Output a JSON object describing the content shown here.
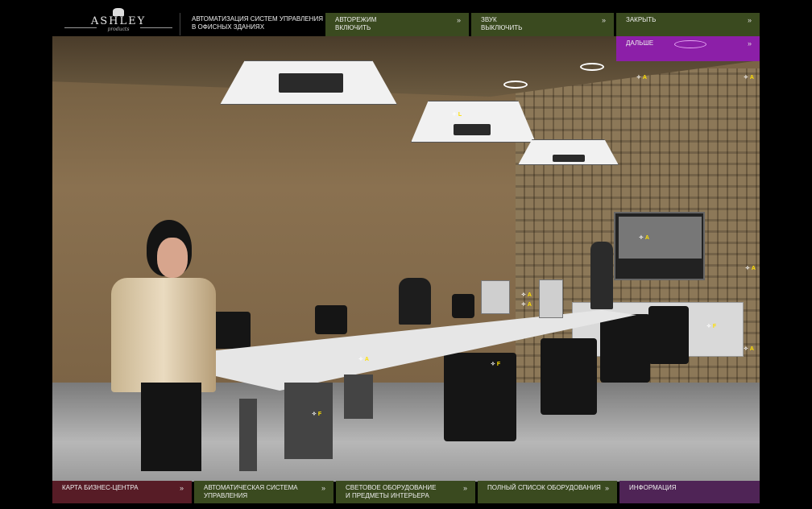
{
  "logo": {
    "brand": "ASHLEY",
    "sub": "products"
  },
  "header": {
    "title_line1": "АВТОМАТИЗАЦИЯ СИСТЕМ УПРАВЛЕНИЯ",
    "title_line2": "В ОФИСНЫХ ЗДАНИЯХ"
  },
  "nav": [
    {
      "line1": "АВТОРЕЖИМ",
      "line2": "ВКЛЮЧИТЬ",
      "arrow": "»"
    },
    {
      "line1": "ЗВУК",
      "line2": "ВЫКЛЮЧИТЬ",
      "arrow": "»"
    },
    {
      "line1": "ЗАКРЫТЬ",
      "line2": "",
      "arrow": "»"
    }
  ],
  "next_button": {
    "label": "ДАЛЬШЕ",
    "arrow": "»"
  },
  "hotspots": [
    "A",
    "A",
    "L",
    "A",
    "A",
    "A",
    "A",
    "A",
    "F",
    "A",
    "F",
    "F"
  ],
  "bottom_nav": [
    {
      "line1": "КАРТА БИЗНЕС-ЦЕНТРА",
      "line2": "",
      "arrow": "»"
    },
    {
      "line1": "АВТОМАТИЧЕСКАЯ СИСТЕМА",
      "line2": "УПРАВЛЕНИЯ",
      "arrow": "»"
    },
    {
      "line1": "СВЕТОВОЕ ОБОРУДОВАНИЕ",
      "line2": "И ПРЕДМЕТЫ ИНТЕРЬЕРА",
      "arrow": "»"
    },
    {
      "line1": "ПОЛНЫЙ СПИСОК ОБОРУДОВАНИЯ",
      "line2": "",
      "arrow": "»"
    },
    {
      "line1": "ИНФОРМАЦИЯ",
      "line2": "",
      "arrow": ""
    }
  ],
  "colors": {
    "green": "#3a4a1f",
    "purple": "#8c1fa8",
    "hotspot": "#ffe000"
  }
}
